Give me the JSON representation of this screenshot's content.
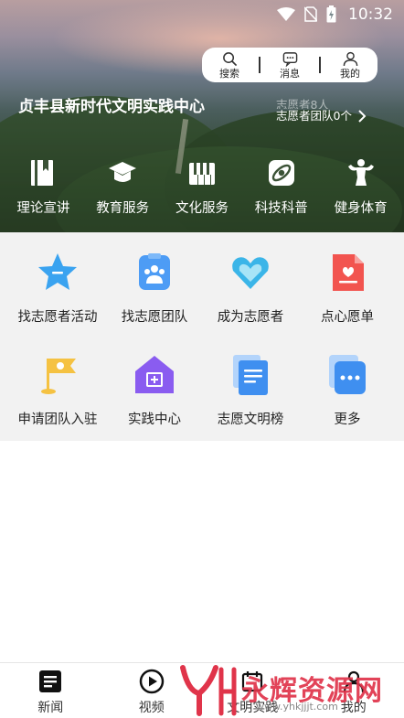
{
  "status": {
    "time": "10:32"
  },
  "top_menu": [
    {
      "label": "搜索",
      "icon": "search-icon"
    },
    {
      "label": "消息",
      "icon": "message-icon"
    },
    {
      "label": "我的",
      "icon": "user-icon"
    }
  ],
  "center": {
    "name": "贞丰县新时代文明实践中心"
  },
  "team": {
    "faded_text": "志愿者8人",
    "count_text": "志愿者团队0个"
  },
  "categories": [
    {
      "label": "理论宣讲",
      "icon": "book-icon"
    },
    {
      "label": "教育服务",
      "icon": "graduation-cap-icon"
    },
    {
      "label": "文化服务",
      "icon": "piano-icon"
    },
    {
      "label": "科技科普",
      "icon": "satellite-icon"
    },
    {
      "label": "健身体育",
      "icon": "fitness-icon"
    }
  ],
  "services": [
    {
      "label": "找志愿者活动",
      "icon": "star-icon",
      "color": "#3aa3f0"
    },
    {
      "label": "找志愿团队",
      "icon": "team-icon",
      "color": "#4d9cf5"
    },
    {
      "label": "成为志愿者",
      "icon": "heart-hands-icon",
      "color": "#3bb5e8"
    },
    {
      "label": "点心愿单",
      "icon": "wish-list-icon",
      "color": "#f2544f"
    },
    {
      "label": "申请团队入驻",
      "icon": "flag-icon",
      "color": "#f5c242"
    },
    {
      "label": "实践中心",
      "icon": "house-icon",
      "color": "#8a5cf0"
    },
    {
      "label": "志愿文明榜",
      "icon": "document-icon",
      "color": "#3f8ff0"
    },
    {
      "label": "更多",
      "icon": "more-icon",
      "color": "#3f8ff0"
    }
  ],
  "bottom_nav": [
    {
      "label": "新闻",
      "icon": "news-icon"
    },
    {
      "label": "视频",
      "icon": "play-icon"
    },
    {
      "label": "文明实践",
      "icon": "practice-icon"
    },
    {
      "label": "我的",
      "icon": "user-icon"
    }
  ],
  "watermark": {
    "text": "永辉资源网",
    "url": "www.yhkjjjt.com"
  }
}
